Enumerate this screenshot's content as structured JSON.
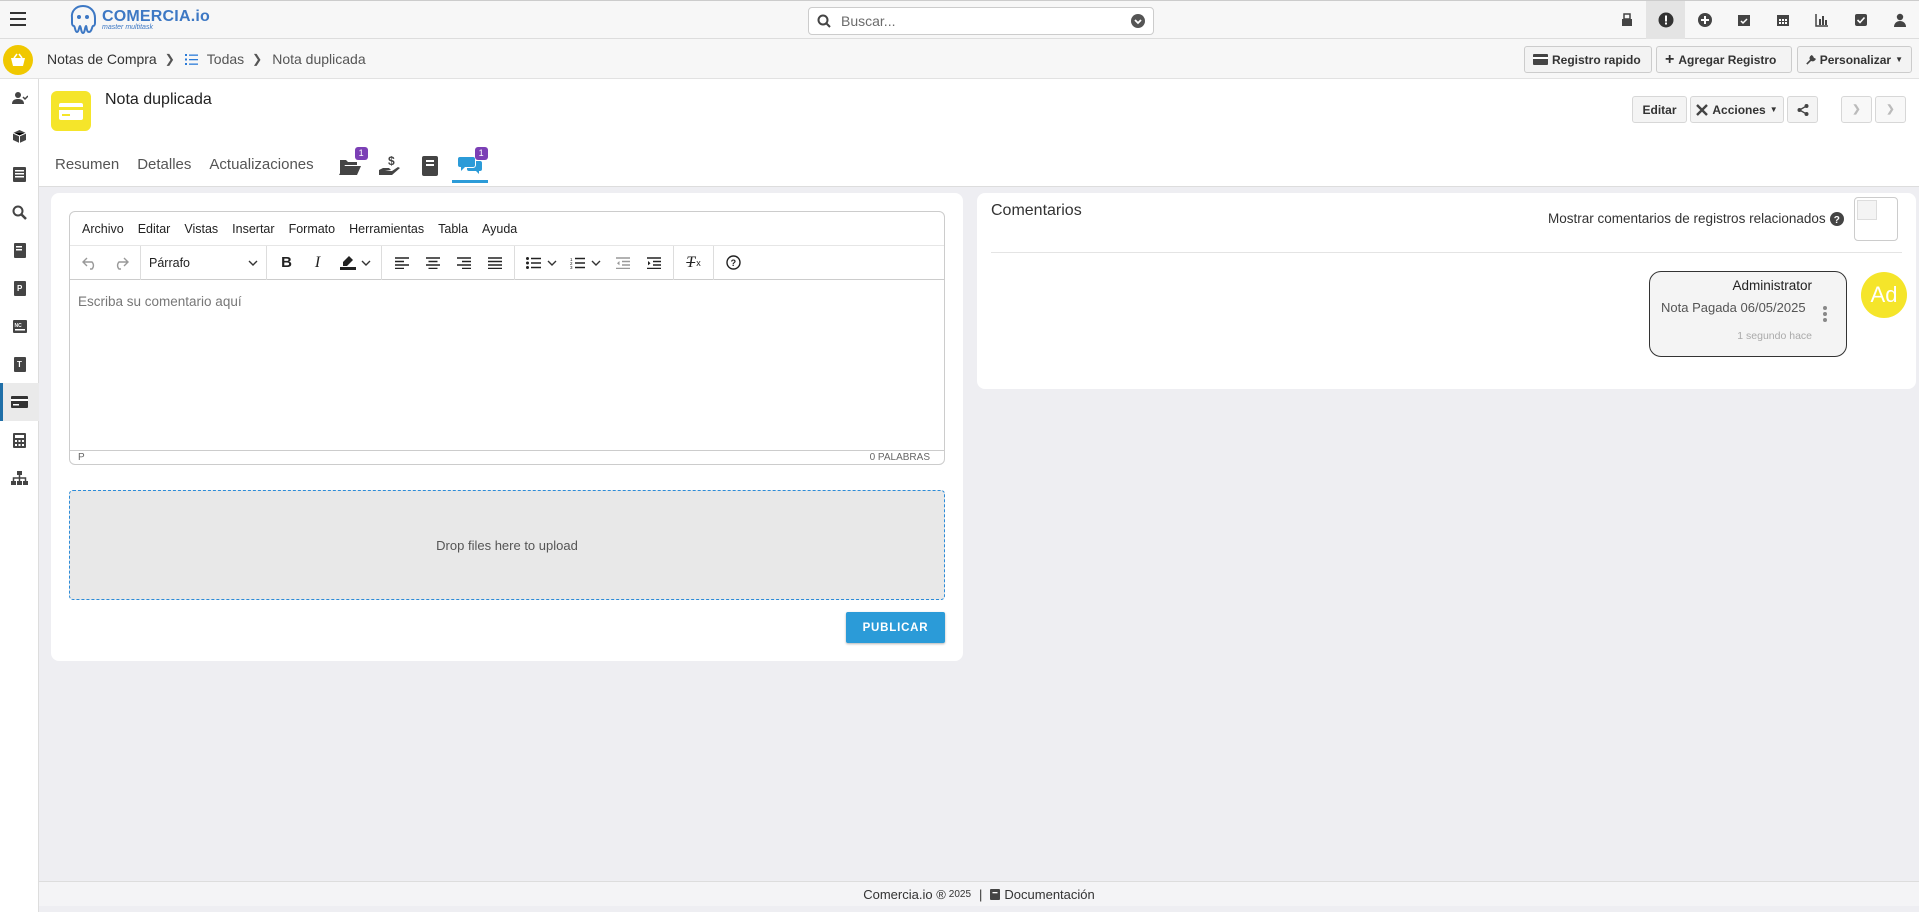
{
  "brand": {
    "name": "COMERCIA.io",
    "tagline": "master multitask"
  },
  "search": {
    "placeholder": "Buscar..."
  },
  "breadcrumb": {
    "module": "Notas de Compra",
    "list": "Todas",
    "current": "Nota duplicada"
  },
  "header_buttons": {
    "quick": "Registro rapido",
    "add": "Agregar Registro",
    "customize": "Personalizar"
  },
  "record": {
    "title": "Nota duplicada",
    "tabs": [
      "Resumen",
      "Detalles",
      "Actualizaciones"
    ],
    "badge_docs": "1",
    "badge_comments": "1",
    "edit_label": "Editar",
    "actions_label": "Acciones"
  },
  "editor": {
    "menu": [
      "Archivo",
      "Editar",
      "Vistas",
      "Insertar",
      "Formato",
      "Herramientas",
      "Tabla",
      "Ayuda"
    ],
    "block_format": "Párrafo",
    "placeholder": "Escriba su comentario aquí",
    "status_path": "P",
    "word_count": "0 PALABRAS",
    "drop_text": "Drop files here to upload",
    "publish_label": "PUBLICAR"
  },
  "comments": {
    "title": "Comentarios",
    "related_toggle_label": "Mostrar comentarios de registros relacionados",
    "items": [
      {
        "author": "Administrator",
        "text": "Nota Pagada 06/05/2025",
        "time": "1 segundo hace",
        "avatar_initials": "Ad"
      }
    ]
  },
  "footer": {
    "copyright": "Comercia.io ®",
    "year": "2025",
    "doc_link": "Documentación"
  },
  "colors": {
    "accent": "#2b9bd8",
    "brand_yellow": "#f5e52a",
    "badge": "#7b3fb5"
  }
}
